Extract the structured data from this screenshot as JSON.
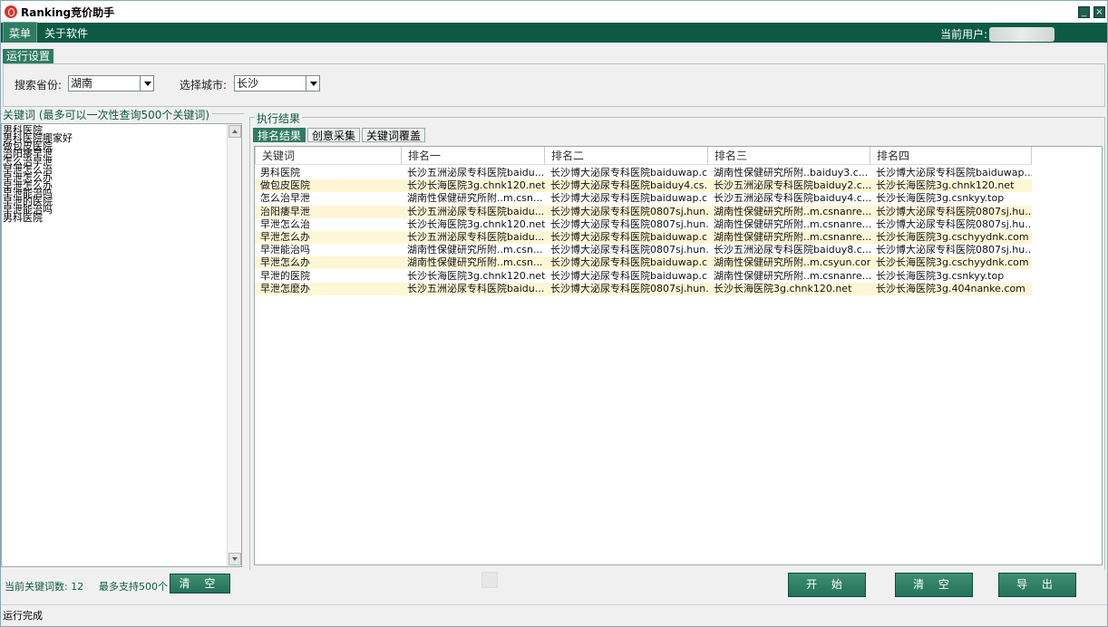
{
  "window": {
    "title": "Ranking竞价助手",
    "minimize": "_",
    "close": "×"
  },
  "menubar": {
    "items": [
      "菜单",
      "关于软件"
    ],
    "user_label": "当前用户:"
  },
  "settings": {
    "tab_label": "运行设置",
    "province_label": "搜索省份:",
    "province_value": "湖南",
    "city_label": "选择城市:",
    "city_value": "长沙"
  },
  "keywords": {
    "title": "关键词 (最多可以一次性查询500个关键词)",
    "items": [
      "男科医院",
      "男科医院哪家好",
      "做包皮医院",
      "治阳痿早泄",
      "怎么治早泄",
      "早泄怎么治",
      "早泄怎么办",
      "早泄怎么办",
      "早泄能治吗",
      "早泄的医院",
      "早泄能治吗",
      "男科医院"
    ],
    "count_label": "当前关键词数: 12",
    "max_label": "最多支持500个",
    "clear_button": "清 空"
  },
  "results": {
    "title": "执行结果",
    "tabs": [
      "排名结果",
      "创意采集",
      "关键词覆盖"
    ],
    "columns": [
      "关键词",
      "排名一",
      "排名二",
      "排名三",
      "排名四"
    ],
    "rows": [
      [
        "男科医院",
        "长沙五洲泌尿专科医院baidu...",
        "长沙博大泌尿专科医院baiduwap.c...",
        "湖南性保健研究所附..baiduy3.c...",
        "长沙博大泌尿专科医院baiduwap...."
      ],
      [
        "做包皮医院",
        "长沙长海医院3g.chnk120.net",
        "长沙博大泌尿专科医院baiduy4.cs...",
        "长沙五洲泌尿专科医院baiduy2.c...",
        "长沙长海医院3g.chnk120.net"
      ],
      [
        "怎么治早泄",
        "湖南性保健研究所附..m.csn...",
        "长沙博大泌尿专科医院baiduwap.c...",
        "长沙五洲泌尿专科医院baiduy4.c...",
        "长沙长海医院3g.csnkyy.top"
      ],
      [
        "治阳痿早泄",
        "长沙五洲泌尿专科医院baidu...",
        "长沙博大泌尿专科医院0807sj.hun...",
        "湖南性保健研究所附..m.csnanre...",
        "长沙博大泌尿专科医院0807sj.hu..."
      ],
      [
        "早泄怎么治",
        "长沙长海医院3g.chnk120.net",
        "长沙博大泌尿专科医院0807sj.hun...",
        "湖南性保健研究所附..m.csnanre...",
        "长沙博大泌尿专科医院0807sj.hu..."
      ],
      [
        "早泄怎么办",
        "长沙五洲泌尿专科医院baidu...",
        "长沙博大泌尿专科医院baiduwap.c...",
        "湖南性保健研究所附..m.csnanre...",
        "长沙长海医院3g.cschyydnk.com"
      ],
      [
        "早泄能治吗",
        "湖南性保健研究所附..m.csn...",
        "长沙博大泌尿专科医院0807sj.hun...",
        "长沙五洲泌尿专科医院baiduy8.c...",
        "长沙博大泌尿专科医院0807sj.hu..."
      ],
      [
        "早泄怎么办",
        "湖南性保健研究所附..m.csn...",
        "长沙博大泌尿专科医院baiduwap.c...",
        "湖南性保健研究所附..m.csyun.com",
        "长沙长海医院3g.cschyydnk.com"
      ],
      [
        "早泄的医院",
        "长沙长海医院3g.chnk120.net",
        "长沙博大泌尿专科医院baiduwap.c...",
        "湖南性保健研究所附..m.csnanre...",
        "长沙长海医院3g.csnkyy.top"
      ],
      [
        "早泄怎麼办",
        "长沙五洲泌尿专科医院baidu...",
        "长沙博大泌尿专科医院0807sj.hun...",
        "长沙长海医院3g.chnk120.net",
        "长沙长海医院3g.404nanke.com"
      ]
    ]
  },
  "actions": {
    "start": "开 始",
    "clear": "清 空",
    "export": "导 出"
  },
  "status": {
    "text": "运行完成"
  }
}
